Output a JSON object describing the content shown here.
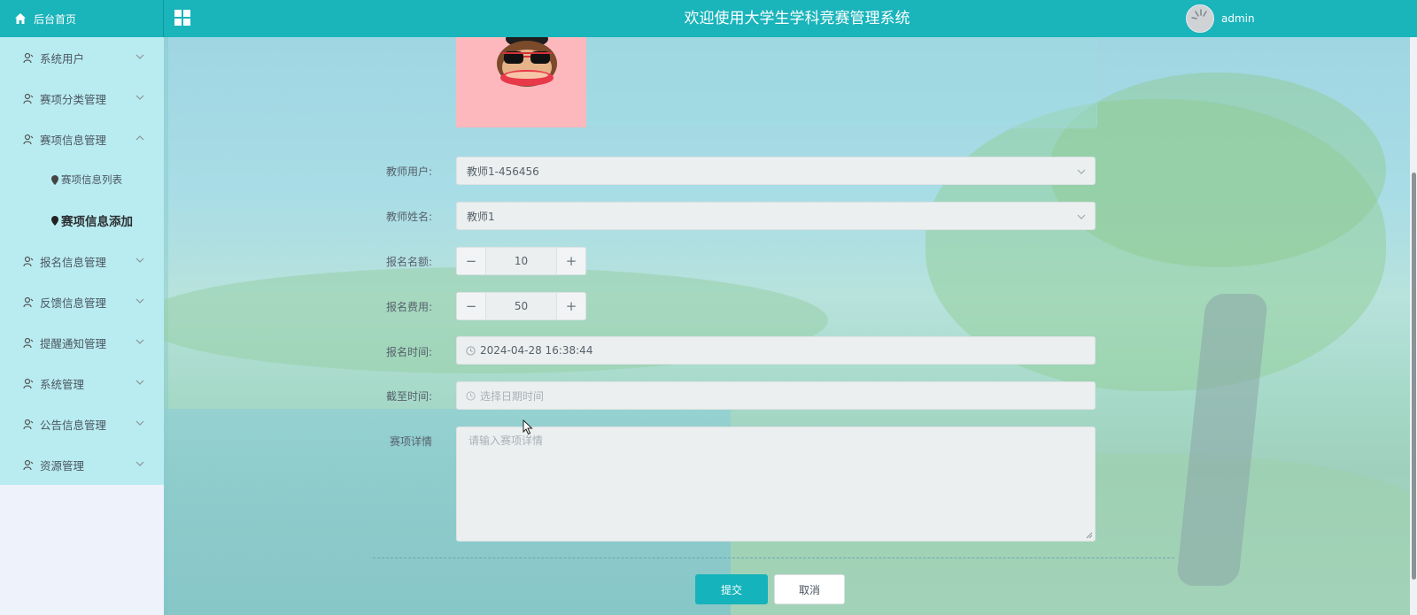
{
  "header": {
    "home_label": "后台首页",
    "title": "欢迎使用大学生学科竞赛管理系统",
    "username": "admin",
    "icons": {
      "home": "home-icon",
      "toggle": "grid-menu-icon",
      "avatar": "avatar"
    }
  },
  "sidebar": {
    "items": [
      {
        "label": "系统用户",
        "expanded": false
      },
      {
        "label": "赛项分类管理",
        "expanded": false
      },
      {
        "label": "赛项信息管理",
        "expanded": true
      },
      {
        "label": "报名信息管理",
        "expanded": false
      },
      {
        "label": "反馈信息管理",
        "expanded": false
      },
      {
        "label": "提醒通知管理",
        "expanded": false
      },
      {
        "label": "系统管理",
        "expanded": false
      },
      {
        "label": "公告信息管理",
        "expanded": false
      },
      {
        "label": "资源管理",
        "expanded": false
      }
    ],
    "subitems": [
      {
        "label": "赛项信息列表",
        "active": false
      },
      {
        "label": "赛项信息添加",
        "active": true
      }
    ]
  },
  "form": {
    "teacher_user": {
      "label": "教师用户:",
      "value": "教师1-456456"
    },
    "teacher_name": {
      "label": "教师姓名:",
      "value": "教师1"
    },
    "quota": {
      "label": "报名名额:",
      "value": "10"
    },
    "fee": {
      "label": "报名费用:",
      "value": "50"
    },
    "signup_time": {
      "label": "报名时间:",
      "value": "2024-04-28 16:38:44"
    },
    "deadline": {
      "label": "截至时间:",
      "placeholder": "选择日期时间"
    },
    "details": {
      "label": "赛项详情",
      "placeholder": "请输入赛项详情"
    }
  },
  "actions": {
    "submit": "提交",
    "cancel": "取消"
  },
  "colors": {
    "accent": "#1ab4bb",
    "sidebar": "#b9ecf0",
    "thumb_bg": "#fdb8bd"
  }
}
